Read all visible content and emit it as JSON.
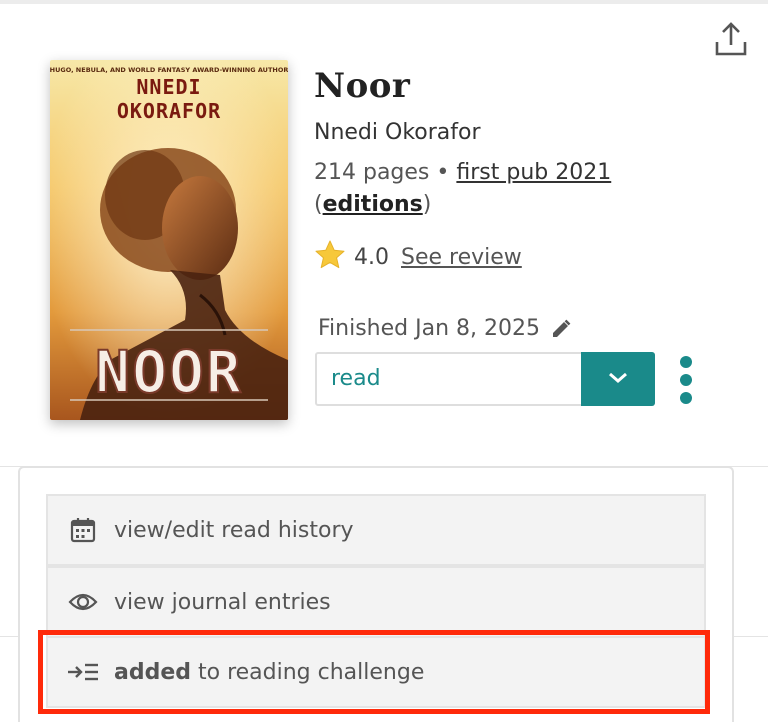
{
  "book": {
    "title": "Noor",
    "author": "Nnedi Okorafor",
    "pages": "214 pages",
    "separator": "•",
    "first_pub": "first pub 2021",
    "editions_open": "(",
    "editions": "editions",
    "editions_close": ")",
    "cover": {
      "tagline": "HUGO, NEBULA, AND WORLD FANTASY AWARD-WINNING AUTHOR",
      "author_line1": "NNEDI",
      "author_line2": "OKORAFOR",
      "title": "NOOR"
    }
  },
  "rating": {
    "value": "4.0",
    "see_review": "See review",
    "star_color": "#f7c83a"
  },
  "status": {
    "finished_text": "Finished Jan 8, 2025",
    "shelf_value": "read",
    "accent": "#1a8a8a"
  },
  "menu": {
    "items": [
      {
        "icon": "calendar-icon",
        "label": "view/edit read history"
      },
      {
        "icon": "eye-icon",
        "label": "view journal entries"
      },
      {
        "icon": "add-to-list-icon",
        "label_bold": "added",
        "label_rest": " to reading challenge"
      }
    ]
  },
  "highlight_color": "#ff2a0a"
}
